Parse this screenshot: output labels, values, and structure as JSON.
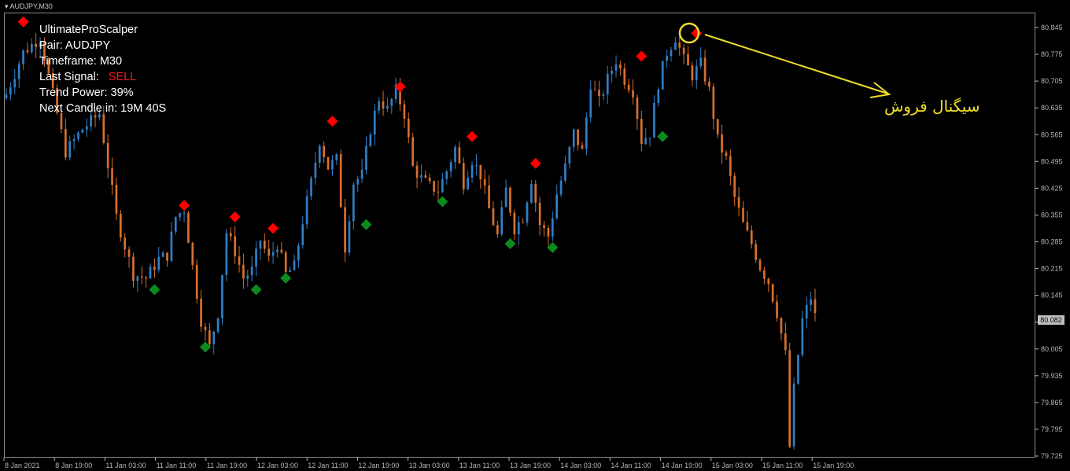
{
  "window": {
    "symbol_tab": "AUDJPY,M30"
  },
  "info_panel": {
    "line1": "UltimateProScalper",
    "pair_label": "Pair: ",
    "pair_value": "AUDJPY",
    "timeframe_label": "Timeframe: ",
    "timeframe_value": "M30",
    "signal_label": "Last Signal: ",
    "signal_value": "SELL",
    "trend_label": "Trend Power: ",
    "trend_value": "39%",
    "next_label": "Next Candle in: ",
    "next_value": "19M 40S"
  },
  "colors": {
    "background": "#000000",
    "bull_candle": "#2f7fc8",
    "bear_candle": "#d8702c",
    "sell_marker": "#ff0000",
    "buy_marker": "#0b8a1e",
    "annotation": "#f0dc2a",
    "axis": "#b4b4b4",
    "signal_text": "#ff1a1a"
  },
  "annotation": {
    "text": "سیگنال فروش",
    "highlight_icon": "circle-highlight",
    "pointer_icon": "arrow-pointer"
  },
  "chart_data": {
    "type": "candlestick",
    "ylim": [
      79.72,
      80.88
    ],
    "y_ticks": [
      "80.845",
      "80.775",
      "80.705",
      "80.635",
      "80.565",
      "80.495",
      "80.425",
      "80.355",
      "80.285",
      "80.215",
      "80.145",
      "80.075",
      "80.005",
      "79.935",
      "79.865",
      "79.795",
      "79.725"
    ],
    "x_ticks": [
      "8 Jan 2021",
      "8 Jan 19:00",
      "11 Jan 03:00",
      "11 Jan 11:00",
      "11 Jan 19:00",
      "12 Jan 03:00",
      "12 Jan 11:00",
      "12 Jan 19:00",
      "13 Jan 03:00",
      "13 Jan 11:00",
      "13 Jan 19:00",
      "14 Jan 03:00",
      "14 Jan 11:00",
      "14 Jan 19:00",
      "15 Jan 03:00",
      "15 Jan 11:00",
      "15 Jan 19:00"
    ],
    "current_price": "80.082",
    "close_path": [
      [
        0,
        80.67
      ],
      [
        4,
        80.78
      ],
      [
        8,
        80.82
      ],
      [
        10,
        80.72
      ],
      [
        14,
        80.52
      ],
      [
        18,
        80.58
      ],
      [
        22,
        80.62
      ],
      [
        26,
        80.35
      ],
      [
        30,
        80.2
      ],
      [
        33,
        80.19
      ],
      [
        36,
        80.24
      ],
      [
        38,
        80.25
      ],
      [
        40,
        80.35
      ],
      [
        42,
        80.37
      ],
      [
        44,
        80.22
      ],
      [
        46,
        80.08
      ],
      [
        48,
        80.01
      ],
      [
        50,
        80.1
      ],
      [
        52,
        80.31
      ],
      [
        54,
        80.26
      ],
      [
        56,
        80.19
      ],
      [
        58,
        80.21
      ],
      [
        60,
        80.29
      ],
      [
        62,
        80.24
      ],
      [
        64,
        80.28
      ],
      [
        66,
        80.2
      ],
      [
        68,
        80.22
      ],
      [
        70,
        80.34
      ],
      [
        72,
        80.44
      ],
      [
        74,
        80.55
      ],
      [
        76,
        80.48
      ],
      [
        78,
        80.5
      ],
      [
        80,
        80.27
      ],
      [
        82,
        80.44
      ],
      [
        84,
        80.46
      ],
      [
        86,
        80.58
      ],
      [
        88,
        80.66
      ],
      [
        90,
        80.63
      ],
      [
        92,
        80.68
      ],
      [
        94,
        80.62
      ],
      [
        96,
        80.48
      ],
      [
        98,
        80.45
      ],
      [
        100,
        80.43
      ],
      [
        102,
        80.42
      ],
      [
        104,
        80.47
      ],
      [
        106,
        80.53
      ],
      [
        108,
        80.44
      ],
      [
        110,
        80.5
      ],
      [
        112,
        80.46
      ],
      [
        114,
        80.37
      ],
      [
        116,
        80.3
      ],
      [
        118,
        80.42
      ],
      [
        120,
        80.32
      ],
      [
        122,
        80.35
      ],
      [
        124,
        80.45
      ],
      [
        126,
        80.33
      ],
      [
        128,
        80.3
      ],
      [
        130,
        80.41
      ],
      [
        132,
        80.48
      ],
      [
        134,
        80.57
      ],
      [
        136,
        80.52
      ],
      [
        138,
        80.7
      ],
      [
        140,
        80.65
      ],
      [
        142,
        80.71
      ],
      [
        144,
        80.76
      ],
      [
        146,
        80.71
      ],
      [
        148,
        80.68
      ],
      [
        150,
        80.55
      ],
      [
        152,
        80.57
      ],
      [
        154,
        80.7
      ],
      [
        156,
        80.78
      ],
      [
        158,
        80.82
      ],
      [
        160,
        80.76
      ],
      [
        162,
        80.72
      ],
      [
        164,
        80.75
      ],
      [
        166,
        80.68
      ],
      [
        168,
        80.55
      ],
      [
        170,
        80.5
      ],
      [
        172,
        80.4
      ],
      [
        174,
        80.33
      ],
      [
        176,
        80.28
      ],
      [
        178,
        80.22
      ],
      [
        180,
        80.18
      ],
      [
        182,
        80.1
      ],
      [
        184,
        79.99
      ],
      [
        185,
        79.75
      ],
      [
        186,
        79.9
      ],
      [
        188,
        80.08
      ],
      [
        190,
        80.14
      ],
      [
        191,
        80.09
      ]
    ],
    "sell_signals": [
      [
        4,
        80.86
      ],
      [
        42,
        80.38
      ],
      [
        54,
        80.35
      ],
      [
        63,
        80.32
      ],
      [
        77,
        80.6
      ],
      [
        93,
        80.69
      ],
      [
        110,
        80.56
      ],
      [
        125,
        80.49
      ],
      [
        150,
        80.77
      ],
      [
        163,
        80.83
      ]
    ],
    "buy_signals": [
      [
        35,
        80.16
      ],
      [
        47,
        80.01
      ],
      [
        59,
        80.16
      ],
      [
        66,
        80.19
      ],
      [
        85,
        80.33
      ],
      [
        103,
        80.39
      ],
      [
        119,
        80.28
      ],
      [
        129,
        80.27
      ],
      [
        155,
        80.56
      ]
    ]
  }
}
